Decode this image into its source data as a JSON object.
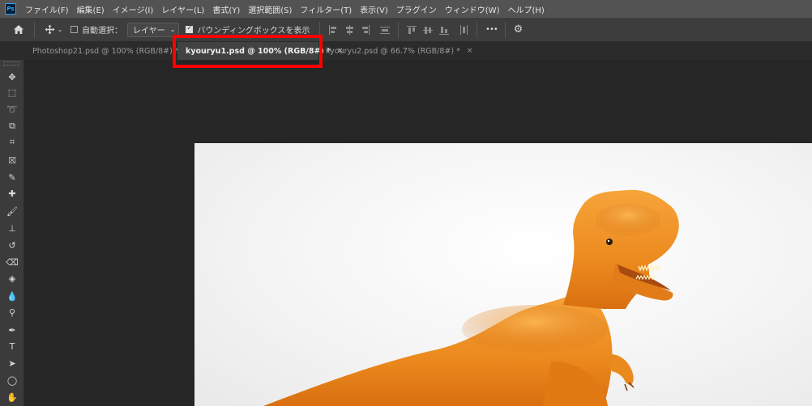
{
  "app": {
    "logo_text": "Ps"
  },
  "menu": [
    "ファイル(F)",
    "編集(E)",
    "イメージ(I)",
    "レイヤー(L)",
    "書式(Y)",
    "選択範囲(S)",
    "フィルター(T)",
    "表示(V)",
    "プラグイン",
    "ウィンドウ(W)",
    "ヘルプ(H)"
  ],
  "options": {
    "auto_select_label": "自動選択：",
    "auto_select_value": "レイヤー",
    "bounding_box_label": "バウンディングボックスを表示",
    "more_label": "•••"
  },
  "tabs": [
    {
      "title": "Photoshop21.psd @ 100% (RGB/8#) *",
      "close": "×"
    },
    {
      "title": "kyouryu1.psd @ 100% (RGB/8#) *",
      "close": "×"
    },
    {
      "title": "kyouryu2.psd @ 66.7% (RGB/8#) *",
      "close": "×"
    }
  ],
  "active_tab": 1,
  "highlight_color": "#ff0000",
  "tools": [
    {
      "name": "move-tool",
      "glyph": "✥"
    },
    {
      "name": "marquee-tool",
      "glyph": "⬚"
    },
    {
      "name": "lasso-tool",
      "glyph": "➰"
    },
    {
      "name": "object-select-tool",
      "glyph": "⧉"
    },
    {
      "name": "crop-tool",
      "glyph": "⌗"
    },
    {
      "name": "frame-tool",
      "glyph": "☒"
    },
    {
      "name": "eyedropper-tool",
      "glyph": "✎"
    },
    {
      "name": "healing-brush-tool",
      "glyph": "✚"
    },
    {
      "name": "brush-tool",
      "glyph": "🖌"
    },
    {
      "name": "clone-stamp-tool",
      "glyph": "⊥"
    },
    {
      "name": "history-brush-tool",
      "glyph": "↺"
    },
    {
      "name": "eraser-tool",
      "glyph": "⌫"
    },
    {
      "name": "paint-bucket-tool",
      "glyph": "◈"
    },
    {
      "name": "blur-tool",
      "glyph": "💧"
    },
    {
      "name": "dodge-tool",
      "glyph": "⚲"
    },
    {
      "name": "pen-tool",
      "glyph": "✒"
    },
    {
      "name": "type-tool",
      "glyph": "T"
    },
    {
      "name": "path-select-tool",
      "glyph": "➤"
    },
    {
      "name": "ellipse-tool",
      "glyph": "◯"
    },
    {
      "name": "hand-tool",
      "glyph": "✋"
    }
  ]
}
